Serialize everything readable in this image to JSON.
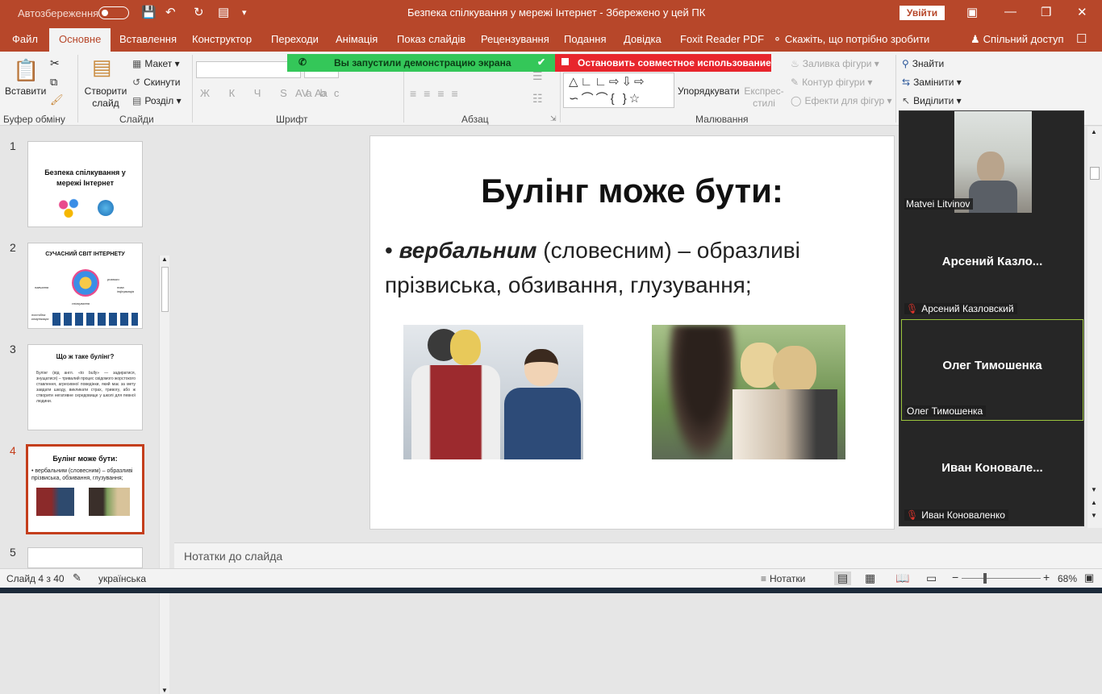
{
  "titlebar": {
    "autosave": "Автозбереження",
    "title": "Безпека спілкування у мережі Інтернет  -  Збережено у цей ПК",
    "signin": "Увійти"
  },
  "tabs": [
    "Файл",
    "Основне",
    "Вставлення",
    "Конструктор",
    "Переходи",
    "Анімація",
    "Показ слайдів",
    "Рецензування",
    "Подання",
    "Довідка",
    "Foxit Reader PDF",
    "Скажіть, що потрібно зробити",
    "Спільний доступ"
  ],
  "ribbon": {
    "paste": "Вставити",
    "clipboard_group": "Буфер обміну",
    "new_slide": "Створити слайд",
    "layout": "Макет",
    "reset": "Скинути",
    "section": "Розділ",
    "slides_group": "Слайди",
    "font_group": "Шрифт",
    "paragraph_group": "Абзац",
    "arrange": "Упорядкувати",
    "quick_styles": "Експрес-стилі",
    "shape_fill": "Заливка фігури",
    "shape_outline": "Контур фігури",
    "shape_effects": "Ефекти для фігур",
    "drawing_group": "Малювання",
    "find": "Знайти",
    "replace": "Замінити",
    "select": "Виділити",
    "share_notice": "Вы запустили демонстрацию экрана",
    "stop_share": "Остановить совместное использование"
  },
  "thumbnails": [
    {
      "num": "1",
      "title": "Безпека спілкування у мережі Інтернет"
    },
    {
      "num": "2",
      "title": "СУЧАСНИЙ СВІТ ІНТЕРНЕТУ",
      "labels": [
        "навчання",
        "розваги",
        "нова інформація",
        "спілкування",
        "постійна комунікація"
      ]
    },
    {
      "num": "3",
      "title": "Що ж таке булінг?",
      "body": "Булінг (від англ. «to bully» — задиратися, знущатися) – тривалий процес свідомого жорстокого ставлення, агресивної поведінки, який має за мету завдати шкоду, викликати страх, тривогу, або ж створити негативне середовище у школі для певної людини."
    },
    {
      "num": "4",
      "title": "Булінг може бути:",
      "bullet": "вербальним (словесним) – образливі прізвиська, обзивання, глузування;"
    },
    {
      "num": "5"
    }
  ],
  "slide": {
    "title": "Булінг може бути:",
    "bullet_bold": "вербальним",
    "bullet_rest": " (словесним) – образливі прізвиська, обзивання, глузування;"
  },
  "notes_placeholder": "Нотатки до слайда",
  "status": {
    "slide_counter": "Слайд 4 з 40",
    "language": "українська",
    "notes_btn": "Нотатки",
    "zoom": "68%"
  },
  "zoom_panel": {
    "participants": [
      {
        "name": "Matvei Litvinov",
        "video": true,
        "muted": false
      },
      {
        "big": "Арсений  Казло...",
        "name": "Арсений Казловский",
        "muted": true
      },
      {
        "big": "Олег Тимошенка",
        "name": "Олег Тимошенка",
        "muted": false,
        "active": true
      },
      {
        "big": "Иван  Коновале...",
        "name": "Иван Коноваленко",
        "muted": true
      }
    ]
  },
  "colors": {
    "accent": "#b7472a",
    "active_slide": "#c43e1c",
    "share_green": "#34c759",
    "share_red": "#e8262d"
  }
}
